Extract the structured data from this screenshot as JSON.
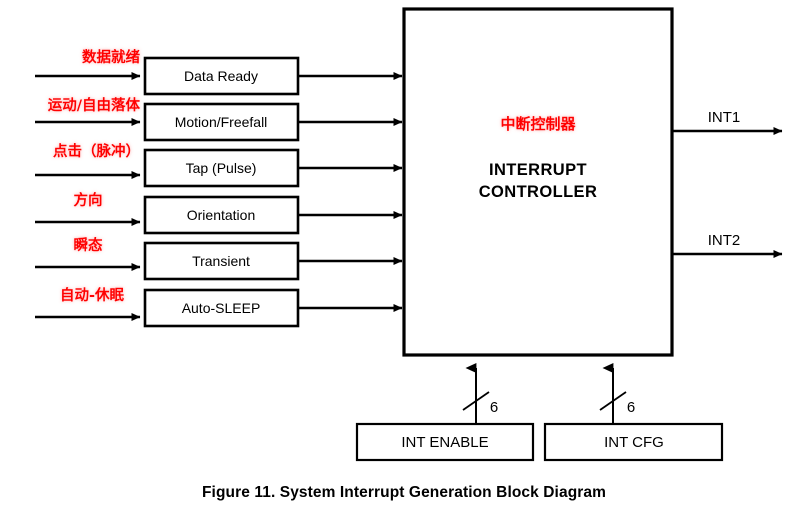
{
  "figure": {
    "caption": "Figure 11. System Interrupt Generation Block Diagram",
    "colors": {
      "annotation_red": "#ff0000",
      "line_black": "#000000",
      "background": "#ffffff"
    }
  },
  "sources": [
    {
      "label": "Data Ready",
      "annotation_zh": "数据就绪"
    },
    {
      "label": "Motion/Freefall",
      "annotation_zh": "运动/自由落体"
    },
    {
      "label": "Tap (Pulse)",
      "annotation_zh": "点击（脉冲）"
    },
    {
      "label": "Orientation",
      "annotation_zh": "方向"
    },
    {
      "label": "Transient",
      "annotation_zh": "瞬态"
    },
    {
      "label": "Auto-SLEEP",
      "annotation_zh": "自动-休眠"
    }
  ],
  "controller": {
    "title_zh": "中断控制器",
    "title_en_line1": "INTERRUPT",
    "title_en_line2": "CONTROLLER"
  },
  "outputs": [
    {
      "label": "INT1"
    },
    {
      "label": "INT2"
    }
  ],
  "config_registers": [
    {
      "label": "INT ENABLE",
      "bus_width": "6"
    },
    {
      "label": "INT CFG",
      "bus_width": "6"
    }
  ]
}
